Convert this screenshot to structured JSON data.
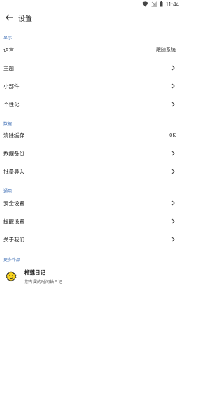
{
  "status_bar": {
    "time": "11:44"
  },
  "header": {
    "title": "设置"
  },
  "sections": {
    "display": {
      "label": "显示",
      "items": [
        {
          "label": "语言",
          "value": "跟随系统"
        },
        {
          "label": "主题"
        },
        {
          "label": "小部件"
        },
        {
          "label": "个性化"
        }
      ]
    },
    "data": {
      "label": "数据",
      "items": [
        {
          "label": "清除缓存",
          "value": "0K"
        },
        {
          "label": "数据备份"
        },
        {
          "label": "批量导入"
        }
      ]
    },
    "general": {
      "label": "通用",
      "items": [
        {
          "label": "安全设置"
        },
        {
          "label": "提醒设置"
        },
        {
          "label": "关于我们"
        }
      ]
    },
    "more": {
      "label": "更多作品",
      "app": {
        "name": "榴莲日记",
        "desc": "您专属的时间轴日记"
      }
    }
  },
  "colors": {
    "accent": "#3F6FB5",
    "logo_yellow": "#F7D21E"
  }
}
